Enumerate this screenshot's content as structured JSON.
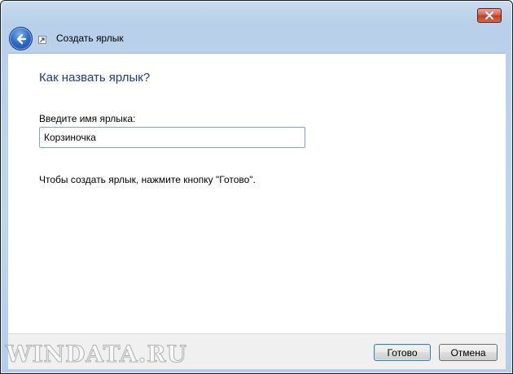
{
  "window": {
    "title": "Создать ярлык"
  },
  "colors": {
    "heading": "#1e3a8a",
    "frame": "#bfd6ee",
    "close_button": "#c13e21"
  },
  "icons": {
    "back": "back-arrow-icon",
    "shortcut": "shortcut-icon",
    "close": "close-icon"
  },
  "content": {
    "heading": "Как назвать ярлык?",
    "name_label": "Введите имя ярлыка:",
    "name_value": "Корзиночка",
    "hint": "Чтобы создать ярлык, нажмите кнопку \"Готово\"."
  },
  "footer": {
    "finish_label": "Готово",
    "cancel_label": "Отмена"
  },
  "watermark": "WINDATA.RU"
}
